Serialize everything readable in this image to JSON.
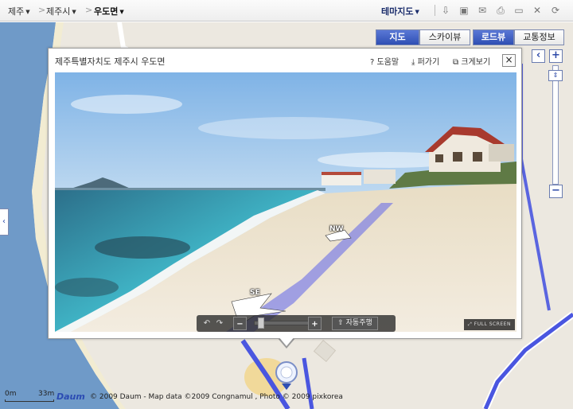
{
  "breadcrumb": [
    {
      "label": "제주"
    },
    {
      "label": "제주시"
    },
    {
      "label": "우도면"
    }
  ],
  "theme_map_label": "테마지도",
  "toolbar_icons": [
    "download-icon",
    "save-icon",
    "mail-icon",
    "print-icon",
    "ruler-icon",
    "share-icon",
    "reset-icon"
  ],
  "map_types": {
    "map": "지도",
    "skyview": "스카이뷰",
    "roadview": "로드뷰",
    "traffic": "교통정보"
  },
  "popup": {
    "title": "제주특별자치도 제주시 우도면",
    "help": "도움말",
    "share": "퍼가기",
    "enlarge": "크게보기"
  },
  "pano": {
    "dir_nw": "NW",
    "dir_se": "SE",
    "auto_play": "자동주행",
    "fullscreen": "FULL SCREEN"
  },
  "footer": {
    "scale_start": "0m",
    "scale_end": "33m",
    "logo": "Daum",
    "copyright": "© 2009 Daum - Map data ©2009 Congnamul , Photo © 2009 pixkorea"
  },
  "colors": {
    "accent": "#2f4fb3",
    "sea": "#6f9ac8",
    "road": "#4a56e0"
  }
}
